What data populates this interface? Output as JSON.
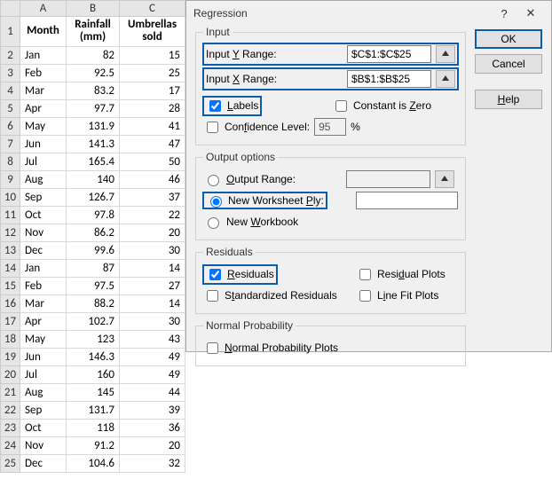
{
  "sheet": {
    "columns": [
      "",
      "A",
      "B",
      "C"
    ],
    "header_row": {
      "num": "1",
      "a": "Month",
      "b": "Rainfall (mm)",
      "c": "Umbrellas sold"
    },
    "rows": [
      {
        "n": "2",
        "a": "Jan",
        "b": "82",
        "c": "15"
      },
      {
        "n": "3",
        "a": "Feb",
        "b": "92.5",
        "c": "25"
      },
      {
        "n": "4",
        "a": "Mar",
        "b": "83.2",
        "c": "17"
      },
      {
        "n": "5",
        "a": "Apr",
        "b": "97.7",
        "c": "28"
      },
      {
        "n": "6",
        "a": "May",
        "b": "131.9",
        "c": "41"
      },
      {
        "n": "7",
        "a": "Jun",
        "b": "141.3",
        "c": "47"
      },
      {
        "n": "8",
        "a": "Jul",
        "b": "165.4",
        "c": "50"
      },
      {
        "n": "9",
        "a": "Aug",
        "b": "140",
        "c": "46"
      },
      {
        "n": "10",
        "a": "Sep",
        "b": "126.7",
        "c": "37"
      },
      {
        "n": "11",
        "a": "Oct",
        "b": "97.8",
        "c": "22"
      },
      {
        "n": "12",
        "a": "Nov",
        "b": "86.2",
        "c": "20"
      },
      {
        "n": "13",
        "a": "Dec",
        "b": "99.6",
        "c": "30"
      },
      {
        "n": "14",
        "a": "Jan",
        "b": "87",
        "c": "14"
      },
      {
        "n": "15",
        "a": "Feb",
        "b": "97.5",
        "c": "27"
      },
      {
        "n": "16",
        "a": "Mar",
        "b": "88.2",
        "c": "14"
      },
      {
        "n": "17",
        "a": "Apr",
        "b": "102.7",
        "c": "30"
      },
      {
        "n": "18",
        "a": "May",
        "b": "123",
        "c": "43"
      },
      {
        "n": "19",
        "a": "Jun",
        "b": "146.3",
        "c": "49"
      },
      {
        "n": "20",
        "a": "Jul",
        "b": "160",
        "c": "49"
      },
      {
        "n": "21",
        "a": "Aug",
        "b": "145",
        "c": "44"
      },
      {
        "n": "22",
        "a": "Sep",
        "b": "131.7",
        "c": "39"
      },
      {
        "n": "23",
        "a": "Oct",
        "b": "118",
        "c": "36"
      },
      {
        "n": "24",
        "a": "Nov",
        "b": "91.2",
        "c": "20"
      },
      {
        "n": "25",
        "a": "Dec",
        "b": "104.6",
        "c": "32"
      }
    ]
  },
  "dialog": {
    "title": "Regression",
    "help_q": "?",
    "buttons": {
      "ok": "OK",
      "cancel": "Cancel",
      "help": "Help"
    },
    "input": {
      "legend": "Input",
      "y_label": "Input Y Range:",
      "y_value": "$C$1:$C$25",
      "x_label": "Input X Range:",
      "x_value": "$B$1:$B$25",
      "labels": "Labels",
      "constant_zero": "Constant is Zero",
      "conf_level": "Confidence Level:",
      "conf_value": "95",
      "pct": "%"
    },
    "output": {
      "legend": "Output options",
      "range": "Output Range:",
      "ply": "New Worksheet Ply:",
      "workbook": "New Workbook"
    },
    "residuals": {
      "legend": "Residuals",
      "residuals": "Residuals",
      "std": "Standardized Residuals",
      "plots": "Residual Plots",
      "linefit": "Line Fit Plots"
    },
    "normal": {
      "legend": "Normal Probability",
      "plots": "Normal Probability Plots"
    }
  }
}
